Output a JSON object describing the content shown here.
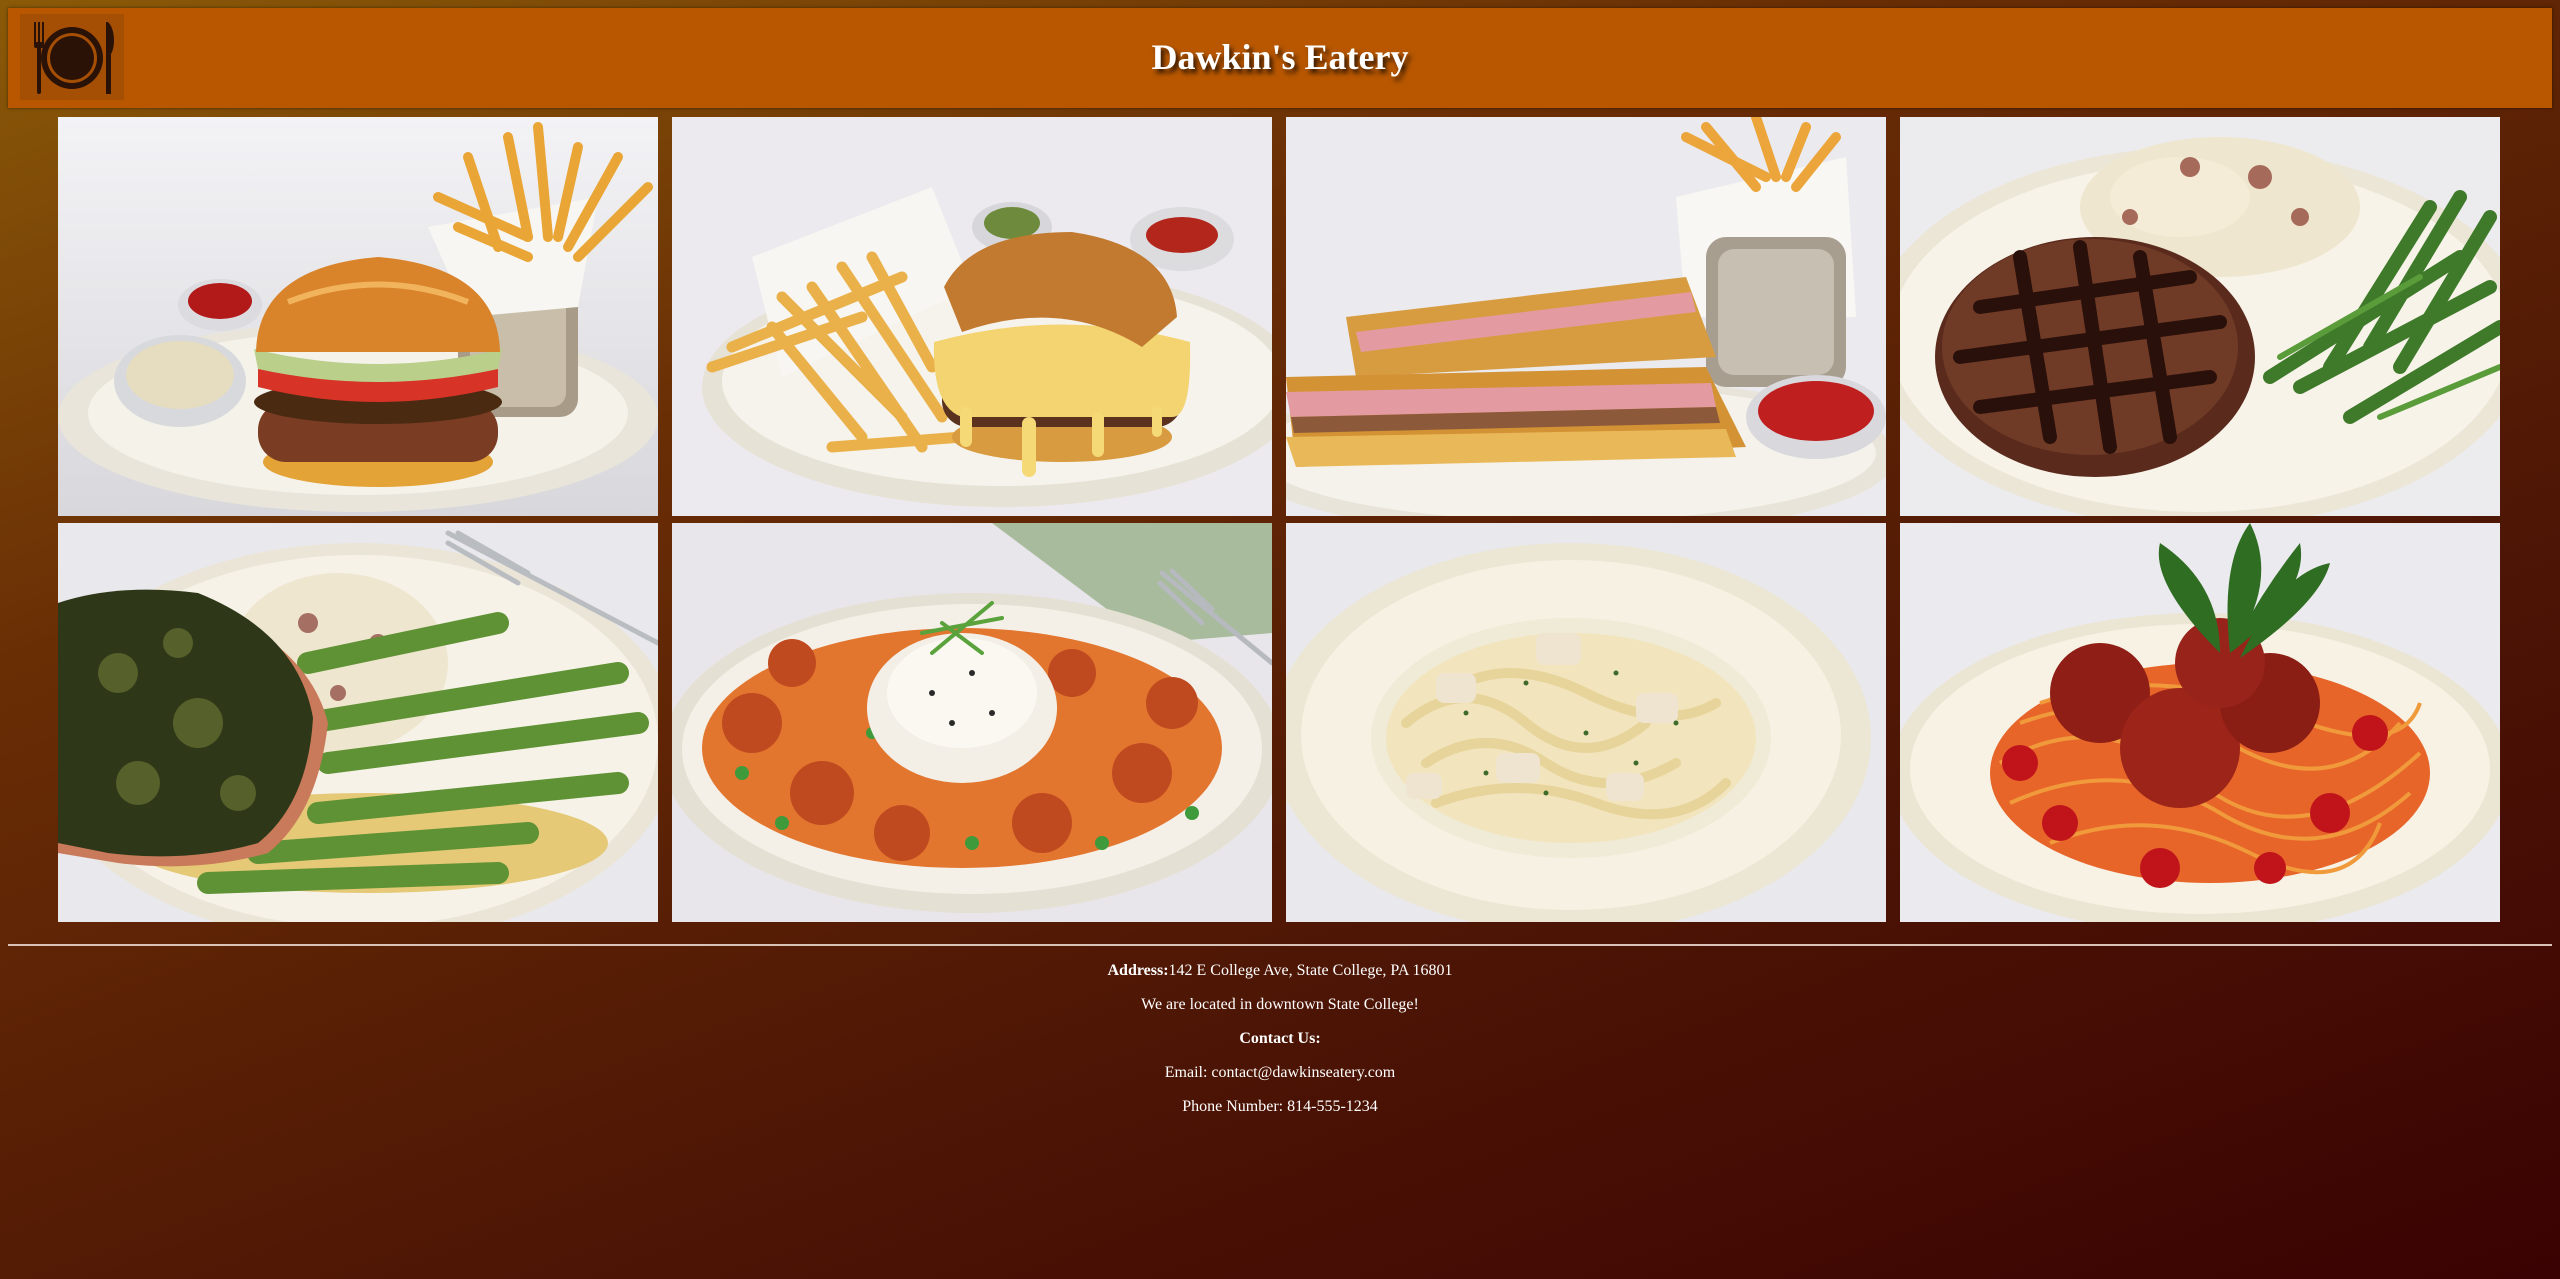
{
  "header": {
    "title": "Dawkin's Eatery",
    "logo_icon": "plate-fork-knife-icon"
  },
  "gallery": {
    "items": [
      {
        "dish": "burger-with-fries-photo"
      },
      {
        "dish": "mac-and-cheese-burger-with-fries-photo"
      },
      {
        "dish": "cuban-sandwich-with-fries-photo"
      },
      {
        "dish": "grilled-steak-with-mashed-potatoes-and-green-beans-photo"
      },
      {
        "dish": "herb-crusted-salmon-with-asparagus-photo"
      },
      {
        "dish": "shrimp-and-rice-platter-photo"
      },
      {
        "dish": "chicken-fettuccine-alfredo-photo"
      },
      {
        "dish": "spaghetti-and-meatballs-photo"
      }
    ]
  },
  "footer": {
    "address_label": "Address:",
    "address_value": "142 E College Ave, State College, PA 16801",
    "location_note": "We are located in downtown State College!",
    "contact_heading": "Contact Us:",
    "email": "Email: contact@dawkinseatery.com",
    "phone": "Phone Number: 814-555-1234"
  },
  "colors": {
    "header_bg": "#b85700",
    "page_gradient_start": "#8a5a08",
    "page_gradient_end": "#3a0202",
    "text": "#ffffff"
  }
}
